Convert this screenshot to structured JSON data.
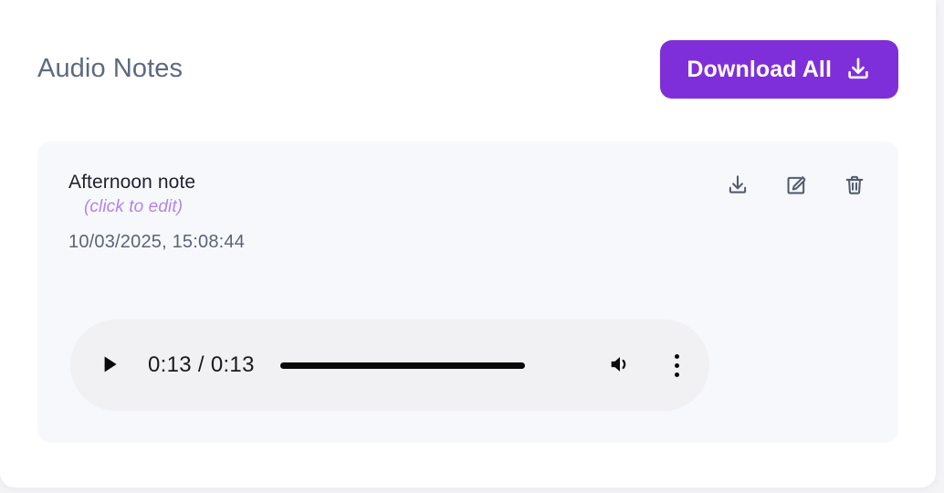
{
  "header": {
    "title": "Audio Notes",
    "download_all_label": "Download All",
    "download_all_icon": "download-icon",
    "accent_color": "#7f2fd9",
    "title_color": "#5e6880"
  },
  "notes": [
    {
      "title": "Afternoon note",
      "edit_hint": "(click to edit)",
      "edit_hint_color": "#b085ec",
      "timestamp": "10/03/2025, 15:08:44",
      "actions": [
        {
          "name": "download-icon",
          "label": "Download"
        },
        {
          "name": "edit-icon",
          "label": "Edit"
        },
        {
          "name": "trash-icon",
          "label": "Delete"
        }
      ],
      "player": {
        "state": "paused",
        "play_icon": "play-icon",
        "current_time": "0:13",
        "duration": "0:13",
        "time_display": "0:13 / 0:13",
        "progress_percent": 100,
        "volume_icon": "volume-icon",
        "menu_icon": "more-vertical-icon",
        "track_color": "#0a0a0a",
        "background": "#f1f1f3"
      }
    }
  ]
}
